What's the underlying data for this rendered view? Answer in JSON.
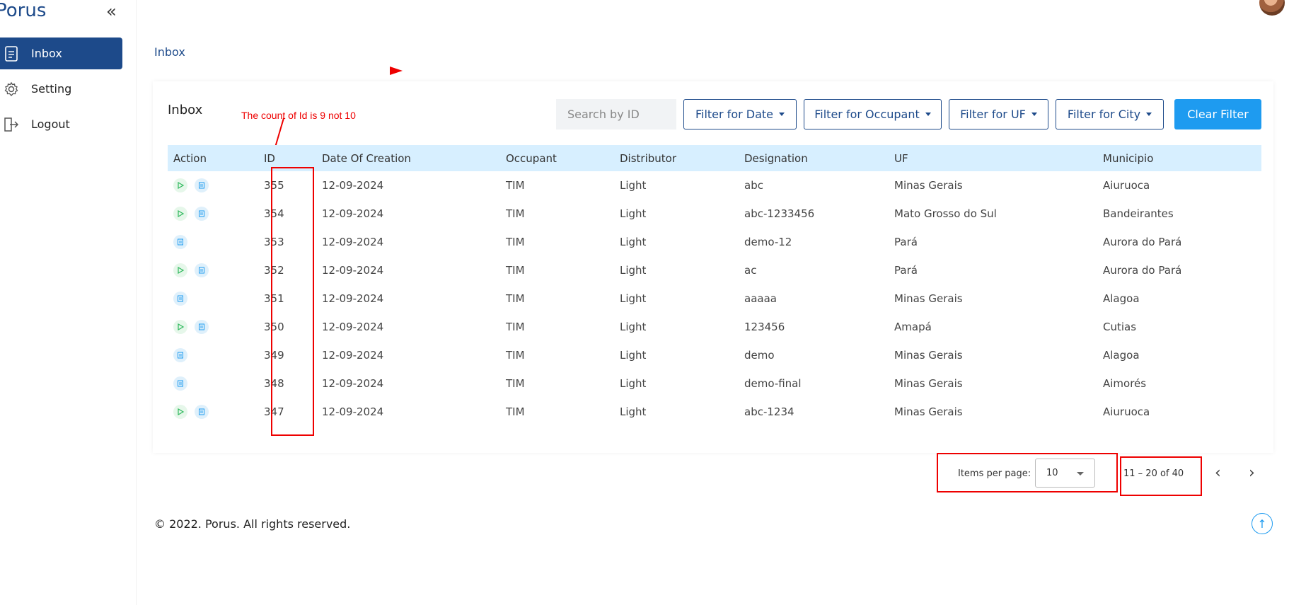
{
  "brand": "Porus",
  "sidebar": {
    "collapse_label": "«",
    "items": [
      {
        "label": "Inbox",
        "icon": "inbox-icon",
        "active": true
      },
      {
        "label": "Setting",
        "icon": "gear-icon",
        "active": false
      },
      {
        "label": "Logout",
        "icon": "logout-icon",
        "active": false
      }
    ]
  },
  "breadcrumb": "Inbox",
  "card": {
    "title": "Inbox",
    "annotation": "The count of Id is 9 not 10",
    "search_placeholder": "Search by ID",
    "filters": [
      "Filter for Date",
      "Filter for Occupant",
      "Filter for UF",
      "Filter for City"
    ],
    "clear_label": "Clear Filter"
  },
  "table": {
    "columns": [
      "Action",
      "ID",
      "Date Of Creation",
      "Occupant",
      "Distributor",
      "Designation",
      "UF",
      "Municipio"
    ],
    "rows": [
      {
        "play": true,
        "id": "355",
        "date": "12-09-2024",
        "occupant": "TIM",
        "distributor": "Light",
        "designation": "abc",
        "uf": "Minas Gerais",
        "municipio": "Aiuruoca"
      },
      {
        "play": true,
        "id": "354",
        "date": "12-09-2024",
        "occupant": "TIM",
        "distributor": "Light",
        "designation": "abc-1233456",
        "uf": "Mato Grosso do Sul",
        "municipio": "Bandeirantes"
      },
      {
        "play": false,
        "id": "353",
        "date": "12-09-2024",
        "occupant": "TIM",
        "distributor": "Light",
        "designation": "demo-12",
        "uf": "Pará",
        "municipio": "Aurora do Pará"
      },
      {
        "play": true,
        "id": "352",
        "date": "12-09-2024",
        "occupant": "TIM",
        "distributor": "Light",
        "designation": "ac",
        "uf": "Pará",
        "municipio": "Aurora do Pará"
      },
      {
        "play": false,
        "id": "351",
        "date": "12-09-2024",
        "occupant": "TIM",
        "distributor": "Light",
        "designation": "aaaaa",
        "uf": "Minas Gerais",
        "municipio": "Alagoa"
      },
      {
        "play": true,
        "id": "350",
        "date": "12-09-2024",
        "occupant": "TIM",
        "distributor": "Light",
        "designation": "123456",
        "uf": "Amapá",
        "municipio": "Cutias"
      },
      {
        "play": false,
        "id": "349",
        "date": "12-09-2024",
        "occupant": "TIM",
        "distributor": "Light",
        "designation": "demo",
        "uf": "Minas Gerais",
        "municipio": "Alagoa"
      },
      {
        "play": false,
        "id": "348",
        "date": "12-09-2024",
        "occupant": "TIM",
        "distributor": "Light",
        "designation": "demo-final",
        "uf": "Minas Gerais",
        "municipio": "Aimorés"
      },
      {
        "play": true,
        "id": "347",
        "date": "12-09-2024",
        "occupant": "TIM",
        "distributor": "Light",
        "designation": "abc-1234",
        "uf": "Minas Gerais",
        "municipio": "Aiuruoca"
      }
    ]
  },
  "paginator": {
    "items_per_page_label": "Items per page:",
    "items_per_page": "10",
    "range": "11 – 20 of 40"
  },
  "footer": "© 2022. Porus. All rights reserved.",
  "colors": {
    "brand": "#1d4a8a",
    "accent": "#1e9bf0",
    "header_bg": "#d7efff",
    "annotation": "#e00000"
  }
}
